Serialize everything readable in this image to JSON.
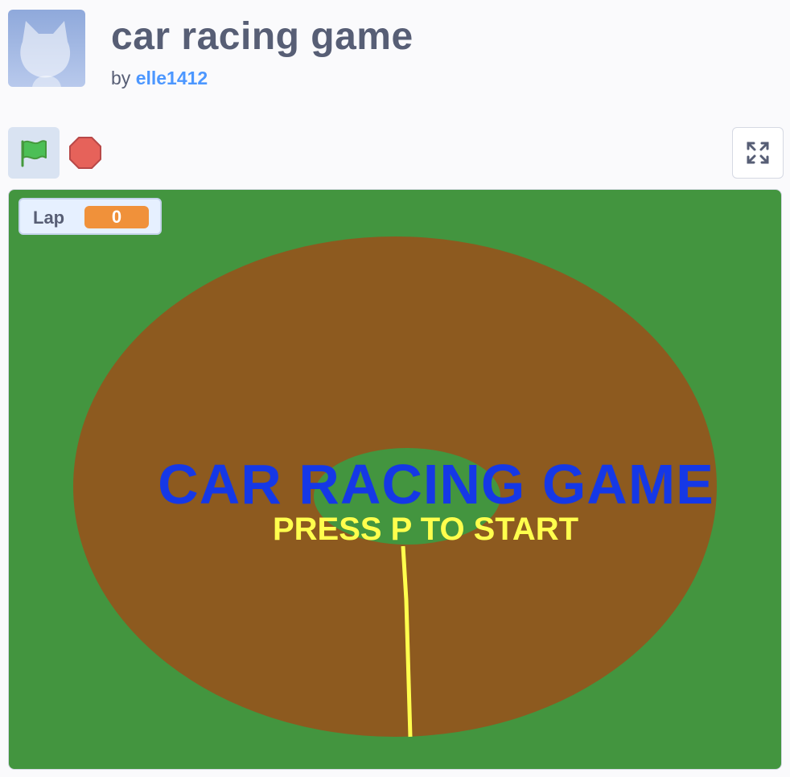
{
  "project": {
    "title": "car racing game",
    "by_prefix": "by",
    "author": "elle1412"
  },
  "controls": {
    "green_flag": "green-flag-icon",
    "stop": "stop-icon",
    "fullscreen": "fullscreen-icon"
  },
  "stage": {
    "monitor": {
      "label": "Lap",
      "value": "0"
    },
    "title_text": "CAR RACING GAME",
    "prompt_text": "PRESS P TO START"
  },
  "colors": {
    "grass": "#43953f",
    "track": "#8d5a1f",
    "finish_line": "#ffff4d",
    "title": "#1538e6",
    "monitor_value": "#f0913a",
    "author_link": "#4c97ff"
  }
}
